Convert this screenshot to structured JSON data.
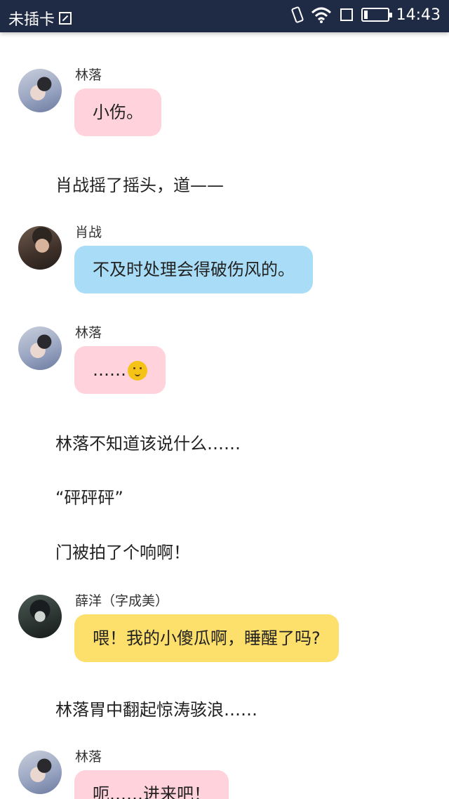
{
  "status_bar": {
    "carrier": "未插卡",
    "time": "14:43",
    "battery_level": 0.15
  },
  "chat": {
    "messages": [
      {
        "type": "bubble",
        "speaker": "林落",
        "text": "小伤。",
        "color": "#ffd2dc"
      },
      {
        "type": "narration",
        "text": "肖战摇了摇头，道——"
      },
      {
        "type": "bubble",
        "speaker": "肖战",
        "text": "不及时处理会得破伤风的。",
        "color": "#a9ddf7"
      },
      {
        "type": "bubble",
        "speaker": "林落",
        "text": "……",
        "emoji": "smiling-face-icon",
        "color": "#ffd2dc"
      },
      {
        "type": "narration",
        "text": "林落不知道该说什么……"
      },
      {
        "type": "narration",
        "text": "“砰砰砰”"
      },
      {
        "type": "narration",
        "text": "门被拍了个响啊！"
      },
      {
        "type": "bubble",
        "speaker": "薛洋（字成美）",
        "text": "喂！我的小傻瓜啊，睡醒了吗?",
        "color": "#fddf6c"
      },
      {
        "type": "narration",
        "text": "林落胃中翻起惊涛骇浪……"
      },
      {
        "type": "bubble",
        "speaker": "林落",
        "text": "呃……进来吧！",
        "color": "#ffd2dc"
      }
    ]
  }
}
